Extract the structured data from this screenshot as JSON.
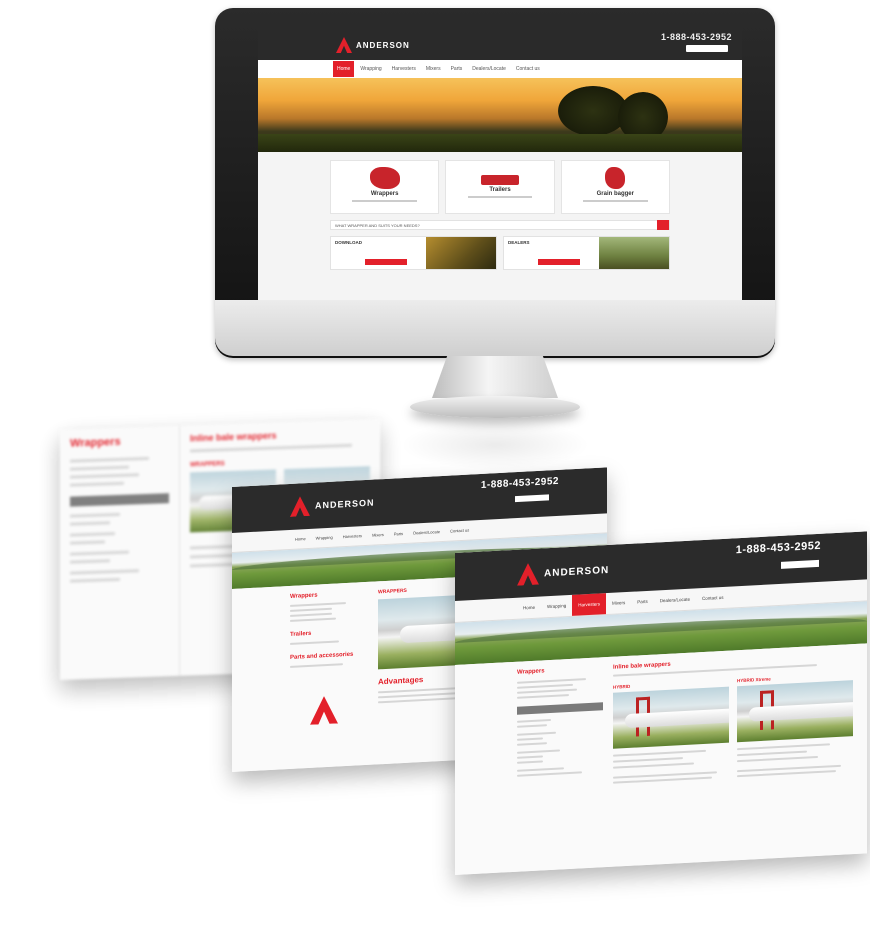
{
  "brand": {
    "name": "ANDERSON",
    "phone": "1-888-453-2952",
    "accent": "#e3202a",
    "dark": "#2b2b2b"
  },
  "monitor_site": {
    "nav": [
      "Home",
      "Wrapping",
      "Harvesters",
      "Mixers",
      "Parts",
      "Dealers/Locate",
      "Contact us"
    ],
    "active_index": 0,
    "products": [
      {
        "label": "Wrappers",
        "icon": "bale-wrapper-icon"
      },
      {
        "label": "Trailers",
        "icon": "trailer-icon"
      },
      {
        "label": "Grain bagger",
        "icon": "grain-bagger-icon"
      }
    ],
    "search_text": "WHAT WRAPPER AND SUITS YOUR NEEDS?",
    "promos": [
      "DOWNLOAD",
      "DEALERS"
    ]
  },
  "page_back": {
    "sidebar_title": "Wrappers",
    "content_title": "Inline bale wrappers",
    "card_title": "WRAPPERS"
  },
  "page_middle": {
    "nav": [
      "Home",
      "Wrapping",
      "Harvesters",
      "Mixers",
      "Parts",
      "Dealers/Locate",
      "Contact us"
    ],
    "active_index": 2,
    "sidebar_sections": [
      "Wrappers",
      "Trailers",
      "Parts and accessories"
    ],
    "content_heading": "Advantages",
    "card_title": "WRAPPERS"
  },
  "page_front": {
    "nav": [
      "Home",
      "Wrapping",
      "Harvesters",
      "Mixers",
      "Parts",
      "Dealers/Locate",
      "Contact us"
    ],
    "active_index": 2,
    "sidebar_title": "Wrappers",
    "content_title": "Inline bale wrappers",
    "cards": [
      "HYBRID",
      "HYBRID Xtreme"
    ]
  }
}
